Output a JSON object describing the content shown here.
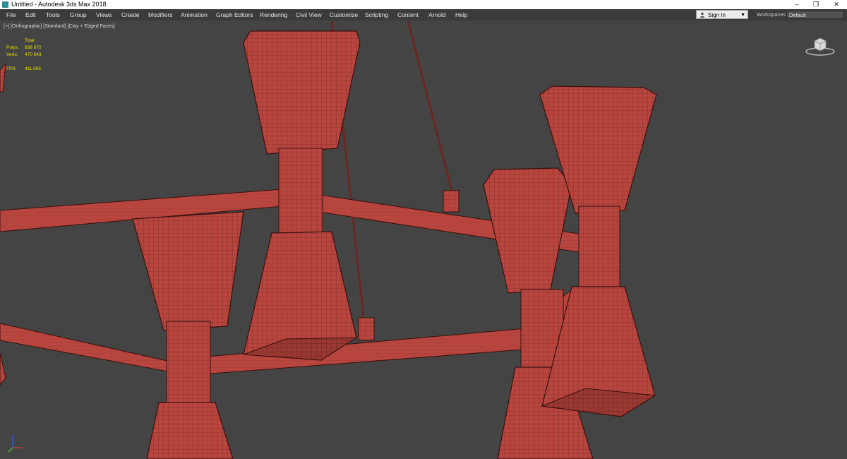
{
  "window": {
    "title": "Untitled - Autodesk 3ds Max 2018",
    "minimize": "–",
    "restore": "❐",
    "close": "✕"
  },
  "menu": [
    "File",
    "Edit",
    "Tools",
    "Group",
    "Views",
    "Create",
    "Modifiers",
    "Animation",
    "Graph Editors",
    "Rendering",
    "Civil View",
    "Customize",
    "Scripting",
    "Content",
    "Arnold",
    "Help"
  ],
  "signin": {
    "label": "Sign In"
  },
  "workspaces": {
    "label": "Workspaces:",
    "value": "Default"
  },
  "viewport": {
    "label_plus": "[+]",
    "label_view": "[Orthographic]",
    "label_shading": "[Standard]",
    "label_mode": "[Clay + Edged Faces]",
    "stats": {
      "header": "Total",
      "polys_label": "Polys:",
      "polys_value": "838 972",
      "verts_label": "Verts:",
      "verts_value": "470 643",
      "fps_label": "FPS:",
      "fps_value": "411,066"
    }
  },
  "colors": {
    "clay": "#b8463e",
    "clay_dark": "#8f2f2a",
    "wire": "#3a0f0d",
    "background": "#444444",
    "stats_text": "#e8e000"
  },
  "icons": [
    "app-icon",
    "user-icon",
    "viewcube-icon",
    "axis-tripod-icon"
  ]
}
